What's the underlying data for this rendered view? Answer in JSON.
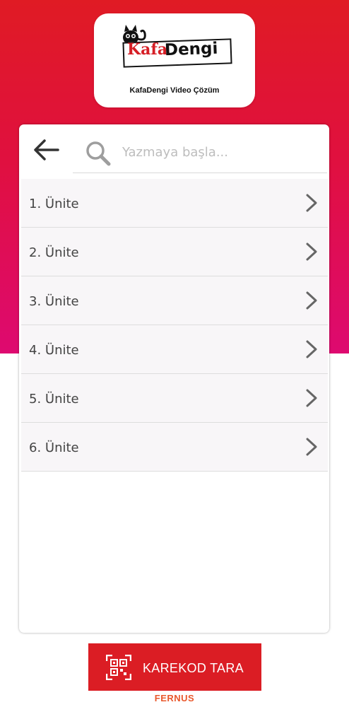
{
  "logo": {
    "kafa": "Kafa",
    "dengi": "Dengi",
    "caption": "KafaDengi Video Çözüm"
  },
  "search": {
    "placeholder": "Yazmaya başla..."
  },
  "units": [
    {
      "label": "1. Ünite"
    },
    {
      "label": "2. Ünite"
    },
    {
      "label": "3. Ünite"
    },
    {
      "label": "4. Ünite"
    },
    {
      "label": "5. Ünite"
    },
    {
      "label": "6. Ünite"
    }
  ],
  "qr_button": {
    "label": "KAREKOD TARA"
  },
  "footer": {
    "brand": "FERNUS"
  },
  "colors": {
    "primary_red": "#db1d24",
    "gradient_top": "#e01b24",
    "gradient_bottom": "#de0a70",
    "brand_orange": "#e9582c"
  },
  "icons": {
    "back": "arrow-left-icon",
    "search": "search-icon",
    "chevron": "chevron-right-icon",
    "qr": "qr-code-icon"
  }
}
